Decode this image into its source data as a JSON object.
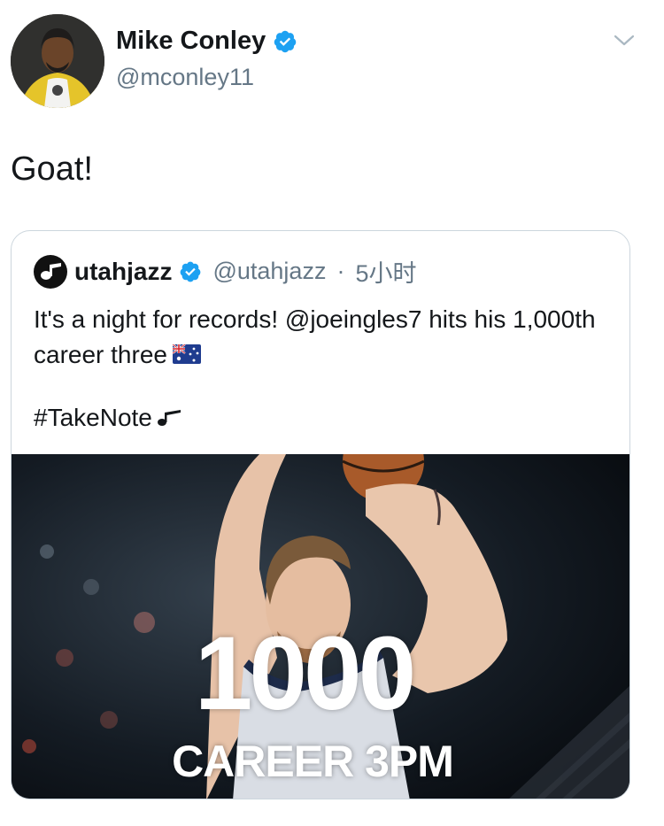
{
  "author": {
    "name": "Mike Conley",
    "handle": "@mconley11",
    "avatar_icon": "profile-photo",
    "verified_color": "#1da1f2"
  },
  "tweet": {
    "text": "Goat!"
  },
  "quoted": {
    "name": "utahjazz",
    "handle": "@utahjazz",
    "separator": "·",
    "time": "5小时",
    "text": "It's a night for records! @joeingles7 hits his 1,000th career three",
    "flag_icon": "australia-flag-icon",
    "hashtag": "#TakeNote",
    "hashtag_icon": "jazz-note-icon",
    "media": {
      "big_number": "1000",
      "caption": "CAREER 3PM",
      "subject": "basketball player shooting"
    }
  },
  "colors": {
    "text_primary": "#14171a",
    "text_secondary": "#657786",
    "border": "#ccd6dd",
    "verified": "#1da1f2"
  }
}
